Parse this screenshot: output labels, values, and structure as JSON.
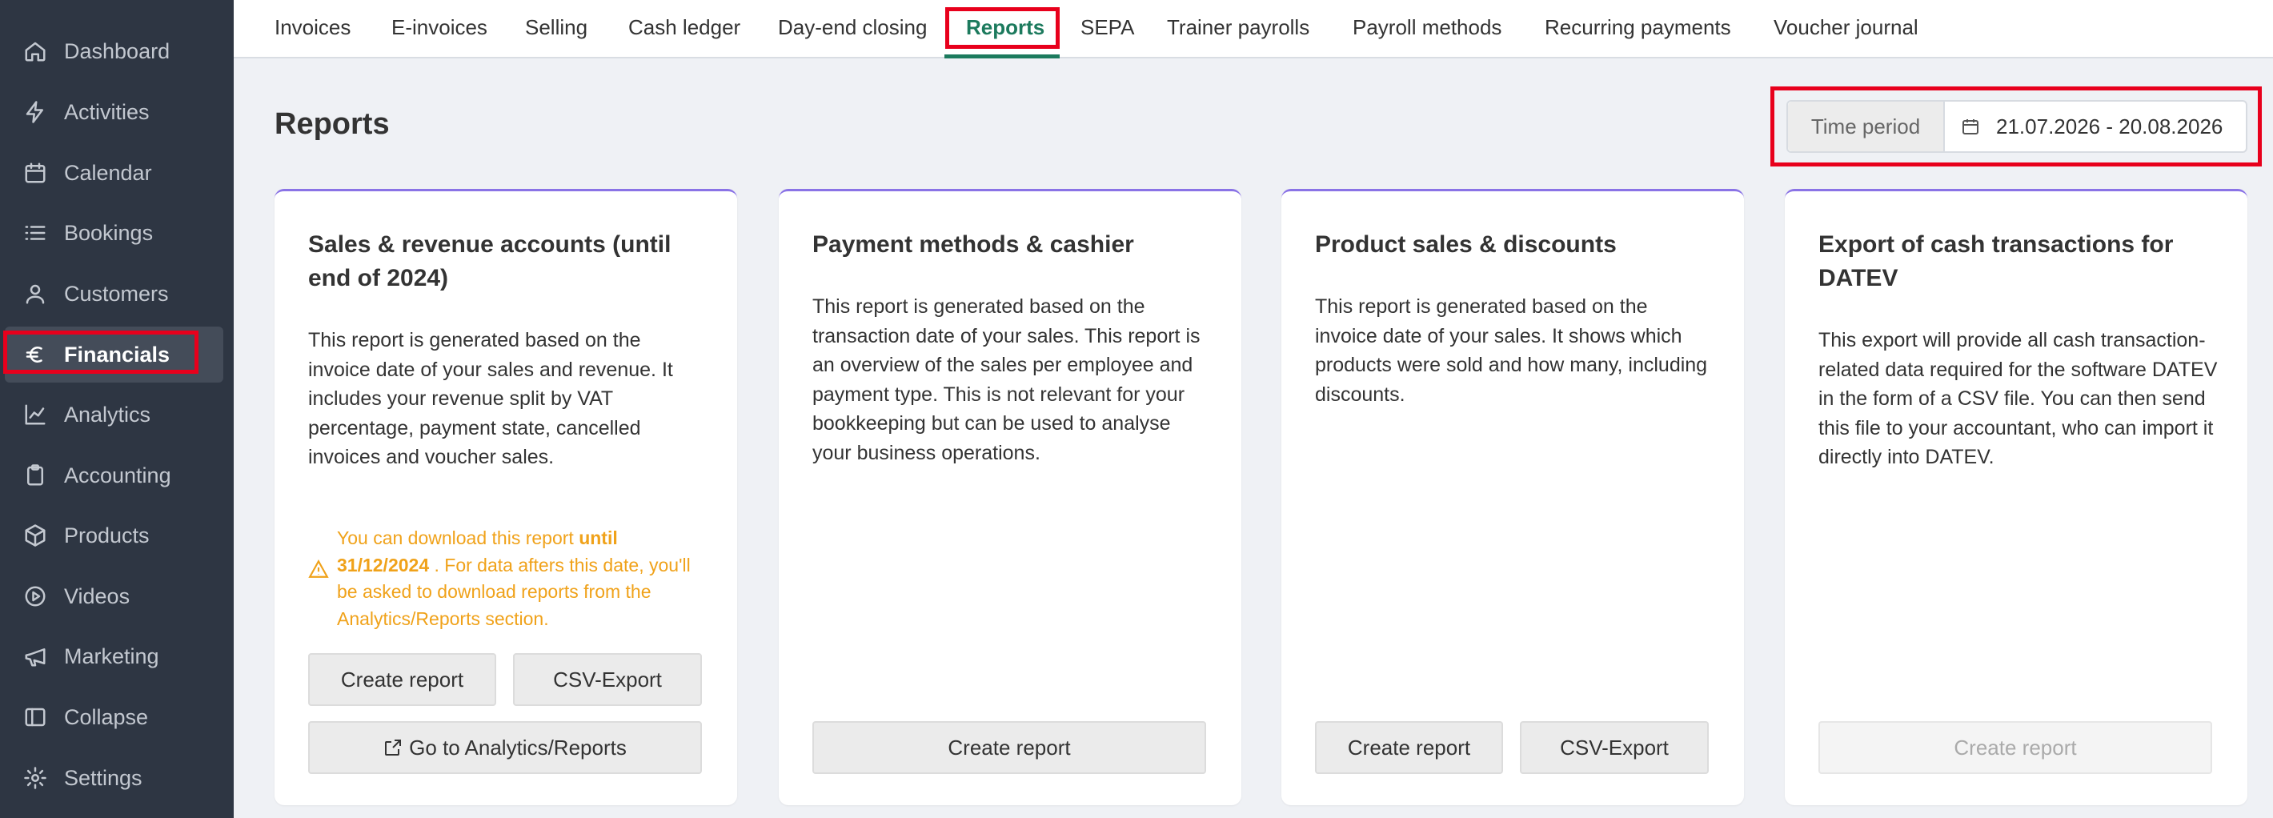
{
  "sidebar": {
    "items": [
      {
        "label": "Dashboard",
        "icon": "home-icon"
      },
      {
        "label": "Activities",
        "icon": "lightning-icon"
      },
      {
        "label": "Calendar",
        "icon": "calendar-icon"
      },
      {
        "label": "Bookings",
        "icon": "list-icon"
      },
      {
        "label": "Customers",
        "icon": "user-icon"
      },
      {
        "label": "Financials",
        "icon": "euro-icon"
      },
      {
        "label": "Analytics",
        "icon": "chart-line-icon"
      },
      {
        "label": "Accounting",
        "icon": "clipboard-icon"
      },
      {
        "label": "Products",
        "icon": "box-icon"
      },
      {
        "label": "Videos",
        "icon": "play-circle-icon"
      },
      {
        "label": "Marketing",
        "icon": "megaphone-icon"
      },
      {
        "label": "Collapse",
        "icon": "collapse-icon"
      },
      {
        "label": "Settings",
        "icon": "gear-icon"
      }
    ],
    "active": "Financials"
  },
  "tabs": [
    "Invoices",
    "E-invoices",
    "Selling",
    "Cash ledger",
    "Day-end closing",
    "Reports",
    "SEPA",
    "Trainer payrolls",
    "Payroll methods",
    "Recurring payments",
    "Voucher journal"
  ],
  "active_tab": "Reports",
  "page": {
    "title": "Reports",
    "time_period_label": "Time period",
    "time_period_value": "21.07.2026 - 20.08.2026"
  },
  "cards": [
    {
      "title": "Sales & revenue accounts (until end of 2024)",
      "description": "This report is generated based on the invoice date of your sales and revenue. It includes your revenue split by VAT percentage, payment state, cancelled invoices and voucher sales.",
      "warning_prefix": "You can download this report ",
      "warning_bold": "until 31/12/2024",
      "warning_suffix": " . For data afters this date, you'll be asked to download reports from the Analytics/Reports section.",
      "buttons": [
        "Create report",
        "CSV-Export"
      ],
      "link_button": "Go to Analytics/Reports"
    },
    {
      "title": "Payment methods & cashier",
      "description": "This report is generated based on the transaction date of your sales. This report is an overview of the sales per employee and payment type. This is not relevant for your bookkeeping but can be used to analyse your business operations.",
      "buttons": [
        "Create report"
      ]
    },
    {
      "title": "Product sales & discounts",
      "description": "This report is generated based on the invoice date of your sales. It shows which products were sold and how many, including discounts.",
      "buttons": [
        "Create report",
        "CSV-Export"
      ]
    },
    {
      "title": "Export of cash transactions for DATEV",
      "description": "This export will provide all cash transaction-related data required for the software DATEV in the form of a CSV file. You can then send this file to your accountant, who can import it directly into DATEV.",
      "buttons": [
        "Create report"
      ],
      "disabled": true
    }
  ],
  "colors": {
    "sidebar_bg": "#2e3643",
    "active_tab": "#1c7a5d",
    "warning": "#f0a21a",
    "highlight": "#e8001c",
    "card_accent": "#8a73e6"
  }
}
